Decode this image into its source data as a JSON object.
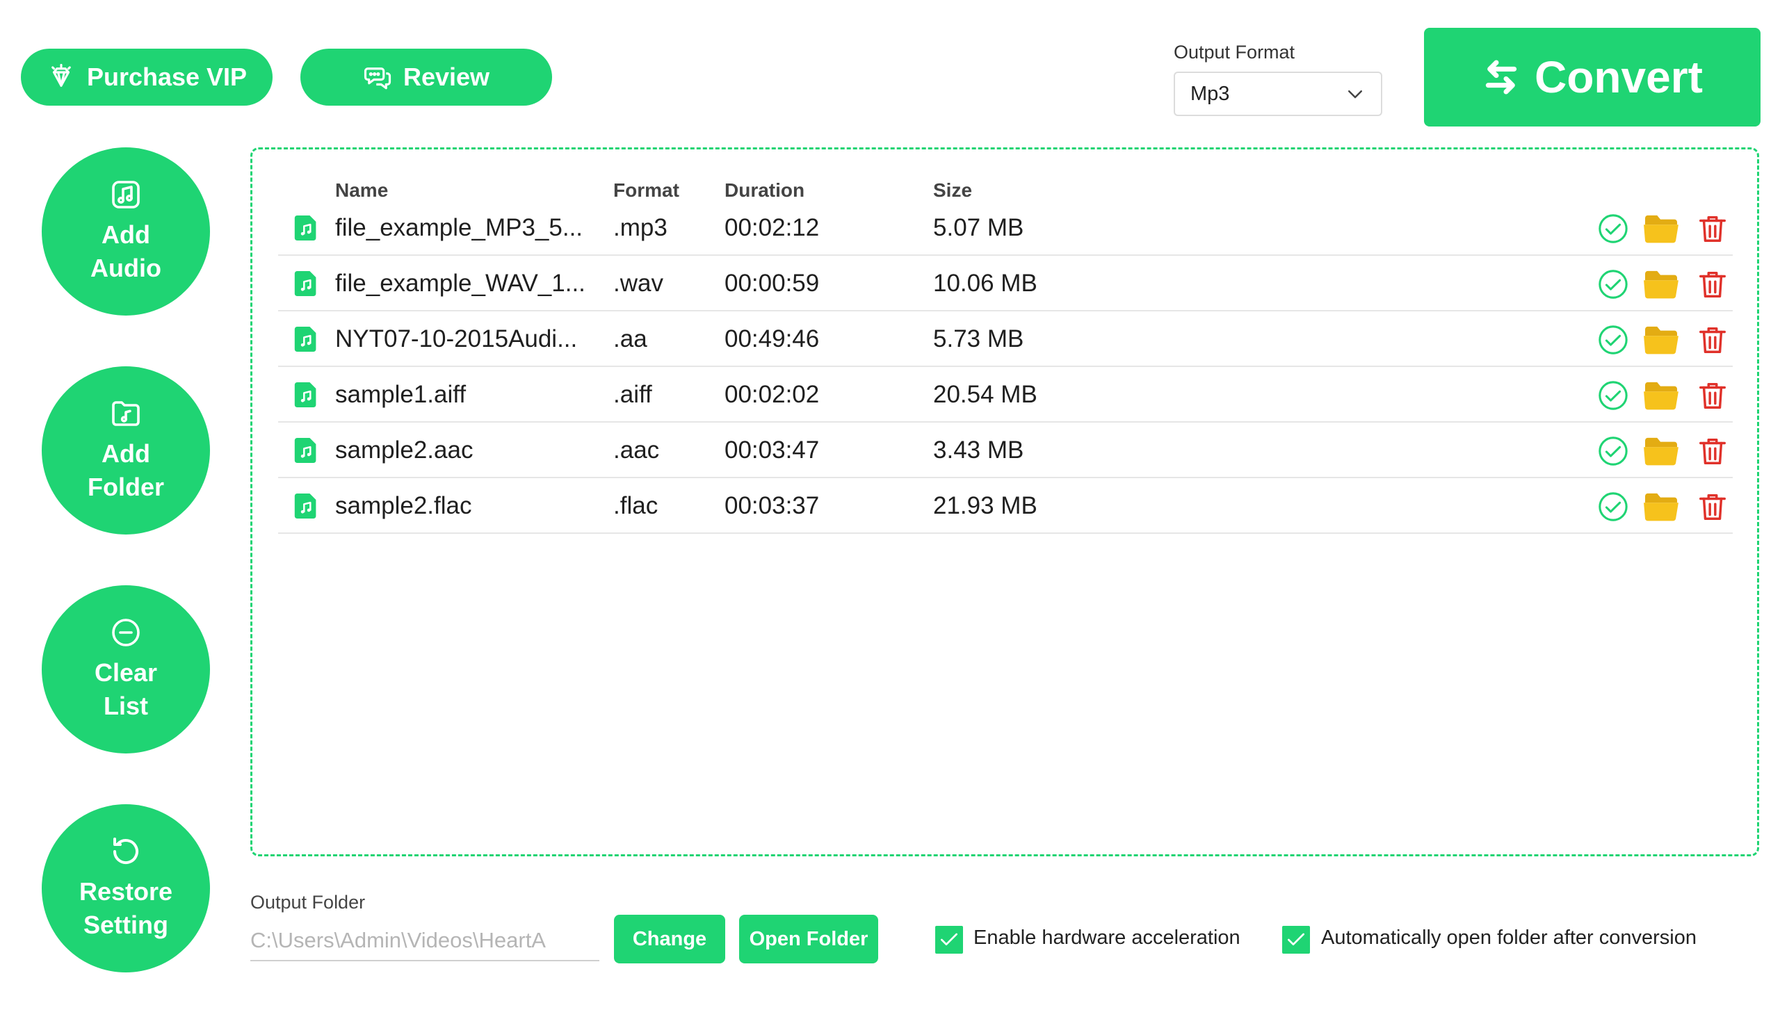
{
  "toolbar": {
    "purchase_label": "Purchase VIP",
    "review_label": "Review",
    "output_format_label": "Output Format",
    "output_format_value": "Mp3",
    "convert_label": "Convert"
  },
  "sidebar": {
    "add_audio": [
      "Add",
      "Audio"
    ],
    "add_folder": [
      "Add",
      "Folder"
    ],
    "clear_list": [
      "Clear",
      "List"
    ],
    "restore_setting": [
      "Restore",
      "Setting"
    ]
  },
  "table": {
    "headers": {
      "name": "Name",
      "format": "Format",
      "duration": "Duration",
      "size": "Size"
    },
    "rows": [
      {
        "name": "file_example_MP3_5...",
        "format": ".mp3",
        "duration": "00:02:12",
        "size": "5.07 MB"
      },
      {
        "name": "file_example_WAV_1...",
        "format": ".wav",
        "duration": "00:00:59",
        "size": "10.06 MB"
      },
      {
        "name": "NYT07-10-2015Audi...",
        "format": ".aa",
        "duration": "00:49:46",
        "size": "5.73 MB"
      },
      {
        "name": "sample1.aiff",
        "format": ".aiff",
        "duration": "00:02:02",
        "size": "20.54 MB"
      },
      {
        "name": "sample2.aac",
        "format": ".aac",
        "duration": "00:03:47",
        "size": "3.43 MB"
      },
      {
        "name": "sample2.flac",
        "format": ".flac",
        "duration": "00:03:37",
        "size": "21.93 MB"
      }
    ]
  },
  "bottom": {
    "output_folder_label": "Output Folder",
    "output_folder_path": "C:\\Users\\Admin\\Videos\\HeartA",
    "change_label": "Change",
    "open_folder_label": "Open Folder",
    "hw_accel_label": "Enable hardware acceleration",
    "hw_accel_checked": true,
    "auto_open_label": "Automatically open folder after conversion",
    "auto_open_checked": true
  },
  "colors": {
    "accent": "#1fd473",
    "folder": "#f6c21c",
    "delete": "#e0312a",
    "dashed_border": "#1fd473"
  },
  "icons": {
    "vip": "diamond-icon",
    "review": "chat-bubbles-icon",
    "convert": "swap-arrows-icon",
    "add_audio": "music-note-square-icon",
    "add_folder": "music-folder-icon",
    "clear_list": "minus-circle-icon",
    "restore_setting": "rotate-ccw-icon",
    "file": "audio-file-icon",
    "status": "check-circle-icon",
    "open": "folder-icon",
    "delete": "trash-icon"
  }
}
